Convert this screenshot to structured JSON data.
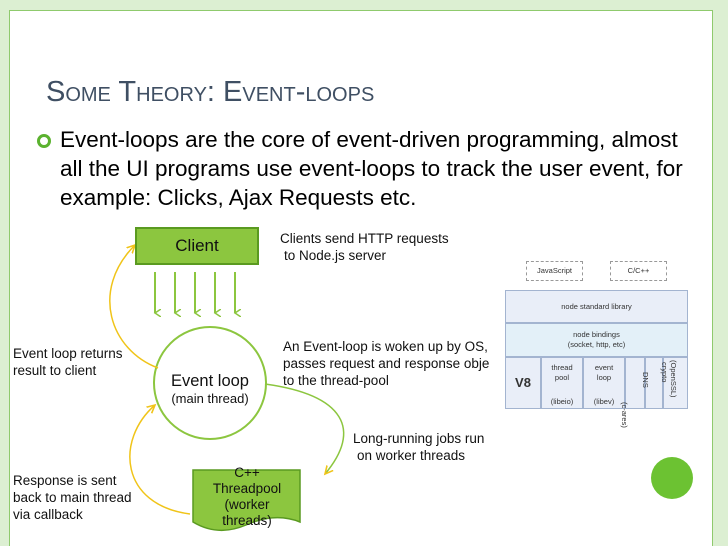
{
  "slide": {
    "title": "Some Theory: Event-loops",
    "bullet": "Event-loops are the core of event-driven programming, almost all the UI programs use event-loops to track the user event, for example: Clicks, Ajax Requests etc."
  },
  "diagram": {
    "client": "Client",
    "event_loop": "Event loop",
    "main_thread": "(main thread)",
    "threadpool_lines": [
      "C++",
      "Threadpool",
      "(worker",
      "threads)"
    ],
    "labels": {
      "clients_send": [
        "Clients send HTTP requests",
        "to Node.js server"
      ],
      "event_loop_woken": [
        "An Event-loop is woken up by OS,",
        "passes request and response obje",
        "to the thread-pool"
      ],
      "long_running": [
        "Long-running jobs run",
        "on worker threads"
      ],
      "returns_result": [
        "Event loop returns",
        "result to client"
      ],
      "response_sent": [
        "Response is sent",
        "back to main thread",
        "via callback"
      ]
    },
    "colors": {
      "green": "#8cc63f",
      "arrow_yellow": "#f0c419",
      "loop_stroke": "#8cc63f"
    }
  },
  "architecture": {
    "top_labels": [
      "JavaScript",
      "C/C++"
    ],
    "node_standard_library": "node standard library",
    "node_bindings": "node bindings",
    "node_bindings_sub": "(socket, http, etc)",
    "v8": "V8",
    "thread_pool": "thread pool",
    "libeio": "(libeio)",
    "event_loop": "event loop",
    "libev": "(libev)",
    "c_ares": "(c-ares)",
    "dns": "DNS",
    "crypto": "crypto",
    "openssl": "(OpenSSL)"
  }
}
